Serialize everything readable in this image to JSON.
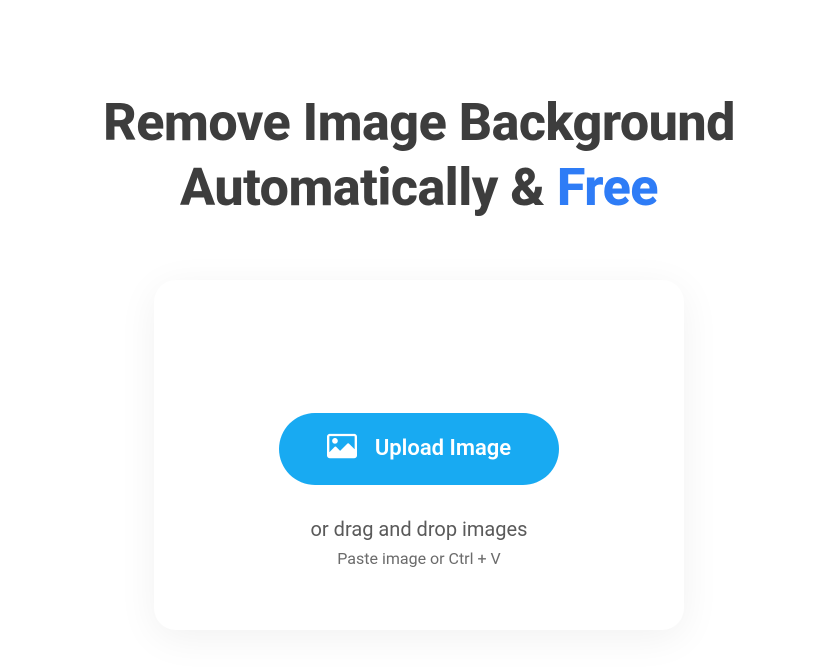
{
  "heading": {
    "line1": "Remove Image Background",
    "line2_prefix": "Automatically & ",
    "line2_highlight": "Free"
  },
  "upload": {
    "button_label": "Upload Image",
    "drag_text": "or drag and drop images",
    "paste_text": "Paste image or Ctrl + V"
  }
}
